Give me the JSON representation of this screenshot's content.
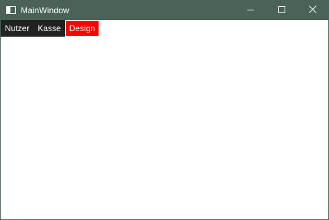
{
  "window": {
    "title": "MainWindow",
    "title_bar_color": "#4a6356",
    "app_icon": "window-app-icon",
    "caption_buttons": [
      {
        "name": "minimize",
        "icon": "minimize-icon"
      },
      {
        "name": "maximize",
        "icon": "maximize-icon"
      },
      {
        "name": "close",
        "icon": "close-icon"
      }
    ]
  },
  "menu": {
    "background": "#222222",
    "items": [
      {
        "label": "Nutzer",
        "active": false
      },
      {
        "label": "Kasse",
        "active": false
      },
      {
        "label": "Design",
        "active": true,
        "color": "#ff0000"
      }
    ]
  }
}
